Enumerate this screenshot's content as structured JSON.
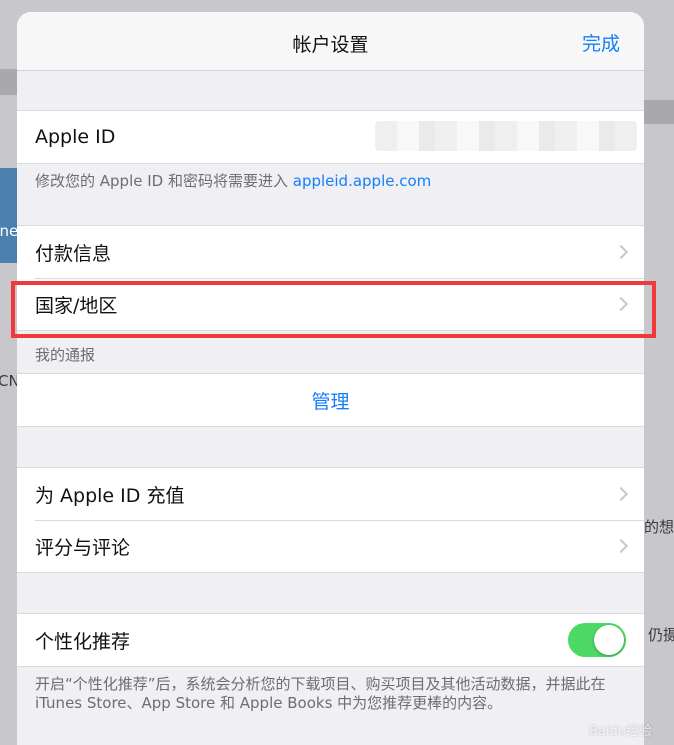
{
  "background": {
    "edge_texts": [
      "une",
      "CN",
      "的想法",
      "仍摄"
    ]
  },
  "sheet": {
    "title": "帐户设置",
    "done_label": "完成"
  },
  "apple_id": {
    "label": "Apple ID",
    "footnote_prefix": "修改您的 Apple ID 和密码将需要进入 ",
    "footnote_link": "appleid.apple.com"
  },
  "payment": {
    "items": [
      {
        "label": "付款信息"
      },
      {
        "label": "国家/地区"
      }
    ]
  },
  "subscriptions": {
    "header": "我的通报",
    "manage_label": "管理"
  },
  "actions": {
    "items": [
      {
        "label": "为 Apple ID 充值"
      },
      {
        "label": "评分与评论"
      }
    ]
  },
  "personalization": {
    "label": "个性化推荐",
    "enabled": true,
    "footnote": "开启“个性化推荐”后，系统会分析您的下载项目、购买项目及其他活动数据，并据此在 iTunes Store、App Store 和 Apple Books 中为您推荐更棒的内容。"
  },
  "watermark": "Baidu经验",
  "colors": {
    "accent": "#147efb",
    "toggle_on": "#4cd964",
    "highlight": "#f03a3a"
  }
}
